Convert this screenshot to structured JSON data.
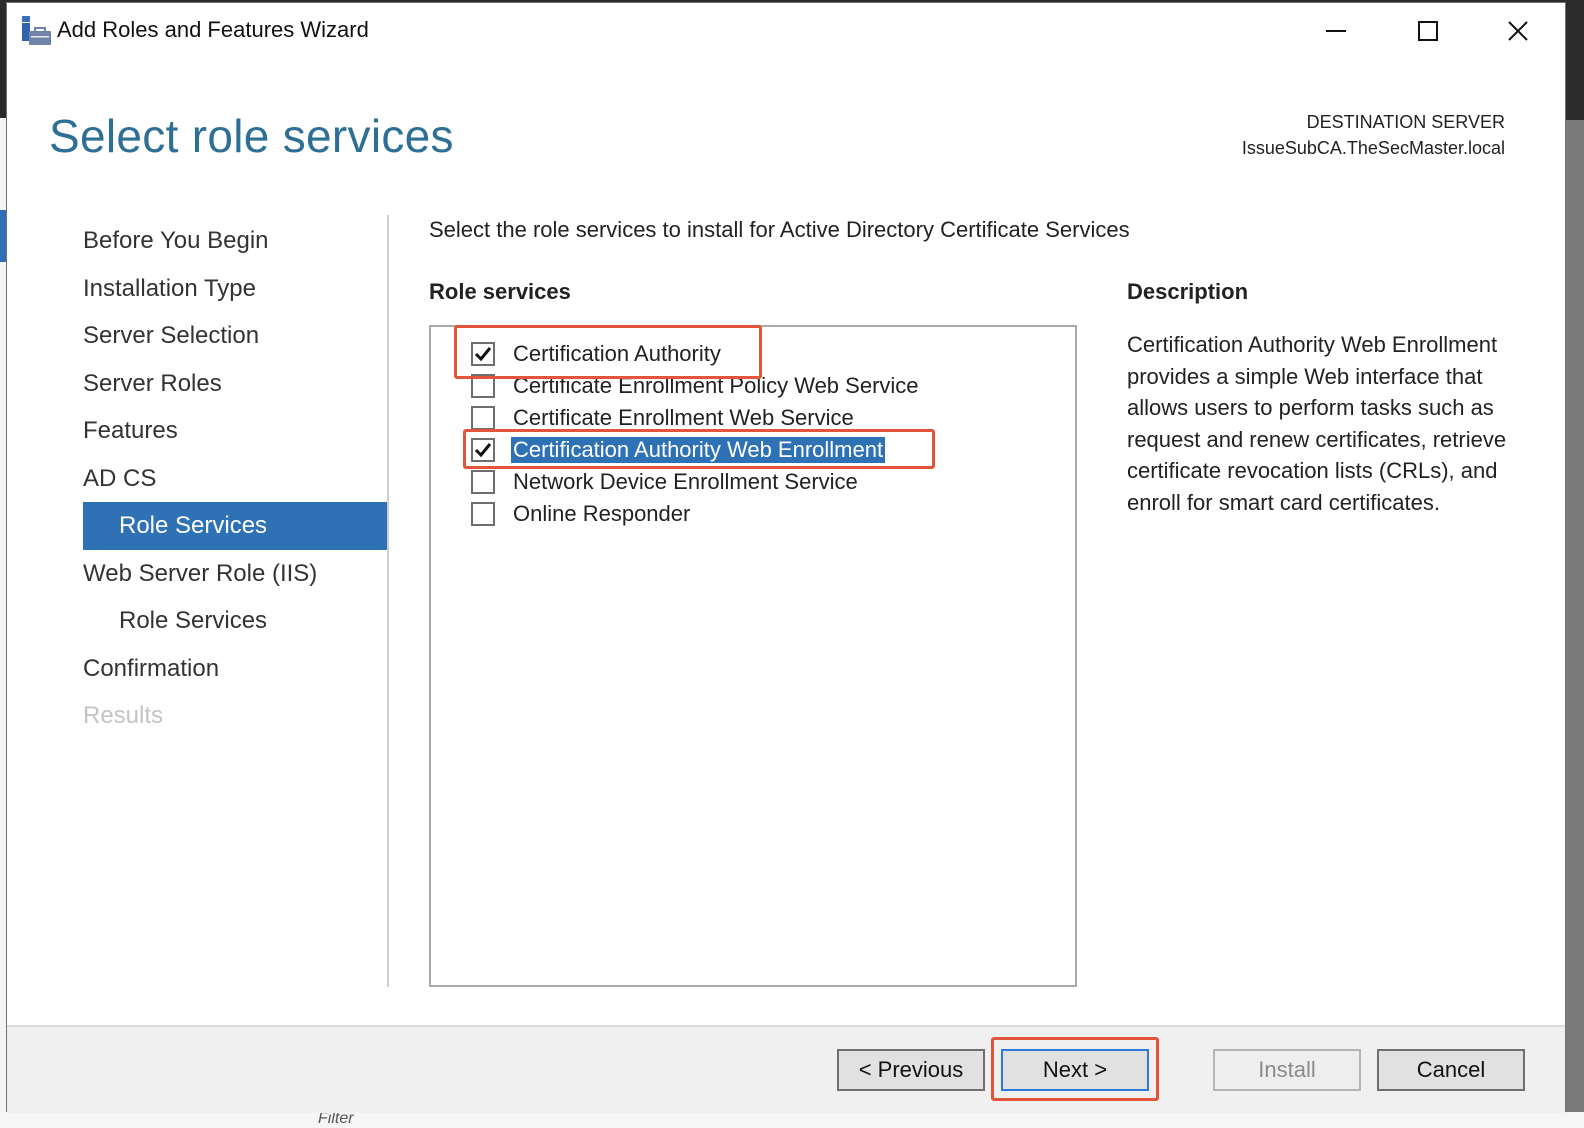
{
  "window": {
    "title": "Add Roles and Features Wizard",
    "icon": "server-manager-icon",
    "controls": [
      "minimize-icon",
      "maximize-icon",
      "close-icon"
    ]
  },
  "header": {
    "page_title": "Select role services",
    "destination_label": "DESTINATION SERVER",
    "destination_server": "IssueSubCA.TheSecMaster.local"
  },
  "nav": {
    "items": [
      {
        "label": "Before You Begin",
        "state": "normal",
        "indent": false
      },
      {
        "label": "Installation Type",
        "state": "normal",
        "indent": false
      },
      {
        "label": "Server Selection",
        "state": "normal",
        "indent": false
      },
      {
        "label": "Server Roles",
        "state": "normal",
        "indent": false
      },
      {
        "label": "Features",
        "state": "normal",
        "indent": false
      },
      {
        "label": "AD CS",
        "state": "normal",
        "indent": false
      },
      {
        "label": "Role Services",
        "state": "active",
        "indent": true
      },
      {
        "label": "Web Server Role (IIS)",
        "state": "normal",
        "indent": false
      },
      {
        "label": "Role Services",
        "state": "normal",
        "indent": true
      },
      {
        "label": "Confirmation",
        "state": "normal",
        "indent": false
      },
      {
        "label": "Results",
        "state": "disabled",
        "indent": false
      }
    ]
  },
  "main": {
    "instruction": "Select the role services to install for Active Directory Certificate Services",
    "role_services_heading": "Role services",
    "role_services": [
      {
        "label": "Certification Authority",
        "checked": true,
        "selected": false,
        "highlighted": true
      },
      {
        "label": "Certificate Enrollment Policy Web Service",
        "checked": false,
        "selected": false,
        "highlighted": false
      },
      {
        "label": "Certificate Enrollment Web Service",
        "checked": false,
        "selected": false,
        "highlighted": false
      },
      {
        "label": "Certification Authority Web Enrollment",
        "checked": true,
        "selected": true,
        "highlighted": true
      },
      {
        "label": "Network Device Enrollment Service",
        "checked": false,
        "selected": false,
        "highlighted": false
      },
      {
        "label": "Online Responder",
        "checked": false,
        "selected": false,
        "highlighted": false
      }
    ],
    "description_heading": "Description",
    "description_text": "Certification Authority Web Enrollment provides a simple Web interface that allows users to perform tasks such as request and renew certificates, retrieve certificate revocation lists (CRLs), and enroll for smart card certificates."
  },
  "footer": {
    "previous_label": "< Previous",
    "next_label": "Next >",
    "install_label": "Install",
    "cancel_label": "Cancel",
    "install_enabled": false,
    "next_highlighted": true
  },
  "background": {
    "filter_placeholder": "Filter"
  },
  "colors": {
    "title_blue": "#2e6f96",
    "selection_blue": "#2f71b5",
    "annotation_red": "#e2553a",
    "focus_blue": "#2c7ad6"
  }
}
